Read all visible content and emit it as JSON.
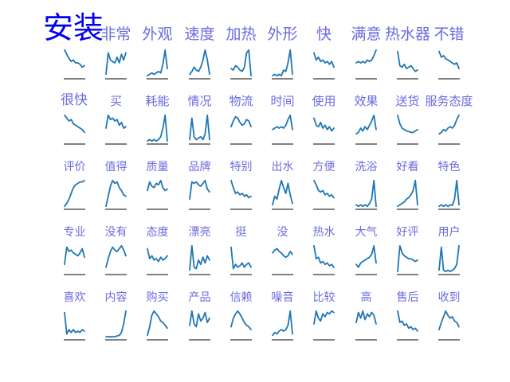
{
  "colors": {
    "line": "#1f77b4",
    "axis": "#000000",
    "label": "#6a6ae0",
    "highlight": "#0000ee",
    "background": "#ffffff"
  },
  "chart_data": {
    "type": "line",
    "title": "",
    "xlabel": "",
    "ylabel": "",
    "grid": false,
    "legend": "none",
    "layout": "small-multiples 10 columns x 5 rows; tick labels hidden; only bottom baseline shown",
    "panels": [
      {
        "label": "安装",
        "emphasis": true,
        "values": [
          0.95,
          0.8,
          0.65,
          0.55,
          0.6,
          0.5,
          0.5,
          0.45,
          0.35,
          0.4
        ]
      },
      {
        "label": "非常",
        "values": [
          0.1,
          0.85,
          0.6,
          0.55,
          0.5,
          0.7,
          0.5,
          0.8,
          0.6,
          0.85
        ]
      },
      {
        "label": "外观",
        "values": [
          0.05,
          0.1,
          0.15,
          0.1,
          0.15,
          0.2,
          0.15,
          0.45,
          0.95,
          0.3
        ]
      },
      {
        "label": "速度",
        "values": [
          0.1,
          0.2,
          0.35,
          0.25,
          0.2,
          0.35,
          0.6,
          0.95,
          0.6,
          0.1
        ]
      },
      {
        "label": "加热",
        "values": [
          0.3,
          0.25,
          0.4,
          0.35,
          0.25,
          0.2,
          0.35,
          0.85,
          0.95,
          0.05
        ]
      },
      {
        "label": "外形",
        "values": [
          0.05,
          0.1,
          0.05,
          0.1,
          0.05,
          0.25,
          0.2,
          0.5,
          0.95,
          0.1
        ]
      },
      {
        "label": "快",
        "values": [
          0.85,
          0.6,
          0.7,
          0.55,
          0.6,
          0.5,
          0.55,
          0.45,
          0.55,
          0.35
        ]
      },
      {
        "label": "满意",
        "values": [
          0.5,
          0.55,
          0.5,
          0.55,
          0.5,
          0.6,
          0.55,
          0.6,
          0.75,
          0.95
        ]
      },
      {
        "label": "热水器",
        "values": [
          0.9,
          0.4,
          0.35,
          0.45,
          0.3,
          0.35,
          0.4,
          0.3,
          0.2,
          0.25
        ]
      },
      {
        "label": "不错",
        "values": [
          0.9,
          0.7,
          0.75,
          0.65,
          0.6,
          0.55,
          0.5,
          0.45,
          0.5,
          0.3
        ]
      },
      {
        "label": "很快",
        "emphasis": true,
        "values": [
          0.95,
          0.85,
          0.75,
          0.8,
          0.65,
          0.6,
          0.55,
          0.5,
          0.45,
          0.35
        ]
      },
      {
        "label": "买",
        "values": [
          0.5,
          0.95,
          0.8,
          0.85,
          0.75,
          0.8,
          0.6,
          0.7,
          0.5,
          0.55
        ]
      },
      {
        "label": "耗能",
        "values": [
          0.05,
          0.1,
          0.05,
          0.1,
          0.05,
          0.1,
          0.2,
          0.5,
          0.95,
          0.05
        ]
      },
      {
        "label": "情况",
        "values": [
          0.1,
          0.85,
          0.2,
          0.1,
          0.15,
          0.2,
          0.1,
          0.3,
          0.95,
          0.1
        ]
      },
      {
        "label": "物流",
        "values": [
          0.55,
          0.75,
          0.9,
          0.85,
          0.7,
          0.6,
          0.65,
          0.8,
          0.75,
          0.55
        ]
      },
      {
        "label": "时间",
        "values": [
          0.45,
          0.5,
          0.55,
          0.5,
          0.55,
          0.5,
          0.6,
          0.8,
          0.95,
          0.45
        ]
      },
      {
        "label": "使用",
        "values": [
          0.85,
          0.6,
          0.55,
          0.7,
          0.5,
          0.6,
          0.45,
          0.55,
          0.4,
          0.5
        ]
      },
      {
        "label": "效果",
        "values": [
          0.3,
          0.35,
          0.5,
          0.4,
          0.55,
          0.45,
          0.6,
          0.75,
          0.95,
          0.45
        ]
      },
      {
        "label": "送货",
        "values": [
          0.95,
          0.65,
          0.5,
          0.45,
          0.4,
          0.38,
          0.35,
          0.35,
          0.4,
          0.45
        ]
      },
      {
        "label": "服务态度",
        "values": [
          0.3,
          0.35,
          0.45,
          0.4,
          0.5,
          0.55,
          0.5,
          0.6,
          0.8,
          0.95
        ]
      },
      {
        "label": "评价",
        "values": [
          0.05,
          0.15,
          0.3,
          0.5,
          0.7,
          0.8,
          0.85,
          0.9,
          0.9,
          0.95
        ]
      },
      {
        "label": "值得",
        "values": [
          0.05,
          0.4,
          0.75,
          0.95,
          0.85,
          0.9,
          0.7,
          0.6,
          0.45,
          0.4
        ]
      },
      {
        "label": "质量",
        "values": [
          0.6,
          0.9,
          0.75,
          0.7,
          0.85,
          0.8,
          0.95,
          0.7,
          0.6,
          0.65
        ]
      },
      {
        "label": "品牌",
        "values": [
          0.3,
          0.9,
          0.85,
          0.9,
          0.8,
          0.75,
          0.85,
          0.95,
          0.65,
          0.55
        ]
      },
      {
        "label": "特别",
        "values": [
          0.95,
          0.7,
          0.5,
          0.55,
          0.45,
          0.5,
          0.4,
          0.45,
          0.35,
          0.4
        ]
      },
      {
        "label": "出水",
        "values": [
          0.1,
          0.4,
          0.3,
          0.65,
          0.95,
          0.7,
          0.5,
          0.85,
          0.45,
          0.15
        ]
      },
      {
        "label": "方便",
        "values": [
          0.95,
          0.8,
          0.6,
          0.55,
          0.6,
          0.45,
          0.5,
          0.4,
          0.45,
          0.35
        ]
      },
      {
        "label": "洗浴",
        "values": [
          0.1,
          0.05,
          0.1,
          0.05,
          0.1,
          0.05,
          0.15,
          0.3,
          0.95,
          0.05
        ]
      },
      {
        "label": "好看",
        "values": [
          0.05,
          0.1,
          0.15,
          0.2,
          0.3,
          0.35,
          0.45,
          0.6,
          0.95,
          0.1
        ]
      },
      {
        "label": "特色",
        "values": [
          0.05,
          0.1,
          0.05,
          0.1,
          0.05,
          0.1,
          0.08,
          0.3,
          0.95,
          0.1
        ]
      },
      {
        "label": "专业",
        "values": [
          0.3,
          0.9,
          0.75,
          0.8,
          0.7,
          0.65,
          0.6,
          0.7,
          0.85,
          0.55
        ]
      },
      {
        "label": "没有",
        "values": [
          0.2,
          0.5,
          0.75,
          0.9,
          0.8,
          0.75,
          0.85,
          0.95,
          0.8,
          0.6
        ]
      },
      {
        "label": "态度",
        "values": [
          0.85,
          0.5,
          0.6,
          0.45,
          0.5,
          0.4,
          0.55,
          0.45,
          0.5,
          0.6
        ]
      },
      {
        "label": "漂亮",
        "values": [
          0.1,
          0.95,
          0.2,
          0.15,
          0.45,
          0.3,
          0.55,
          0.35,
          0.6,
          0.45
        ]
      },
      {
        "label": "挺",
        "values": [
          0.9,
          0.15,
          0.3,
          0.2,
          0.25,
          0.35,
          0.2,
          0.3,
          0.35,
          0.2
        ]
      },
      {
        "label": "没",
        "values": [
          0.7,
          0.8,
          0.85,
          0.75,
          0.7,
          0.6,
          0.55,
          0.6,
          0.75,
          0.65
        ]
      },
      {
        "label": "热水",
        "values": [
          0.95,
          0.5,
          0.55,
          0.35,
          0.4,
          0.3,
          0.35,
          0.25,
          0.3,
          0.2
        ]
      },
      {
        "label": "大气",
        "values": [
          0.3,
          0.2,
          0.35,
          0.4,
          0.45,
          0.5,
          0.55,
          0.65,
          0.95,
          0.35
        ]
      },
      {
        "label": "好评",
        "values": [
          0.05,
          0.95,
          0.7,
          0.6,
          0.55,
          0.5,
          0.5,
          0.45,
          0.4,
          0.45
        ]
      },
      {
        "label": "用户",
        "values": [
          0.1,
          0.9,
          0.1,
          0.05,
          0.1,
          0.05,
          0.1,
          0.15,
          0.3,
          0.95
        ]
      },
      {
        "label": "喜欢",
        "values": [
          0.9,
          0.15,
          0.3,
          0.2,
          0.3,
          0.2,
          0.25,
          0.2,
          0.3,
          0.25
        ]
      },
      {
        "label": "内容",
        "values": [
          0.05,
          0.05,
          0.05,
          0.05,
          0.05,
          0.08,
          0.1,
          0.2,
          0.5,
          0.95
        ]
      },
      {
        "label": "购买",
        "values": [
          0.1,
          0.4,
          0.8,
          0.95,
          0.85,
          0.75,
          0.6,
          0.55,
          0.45,
          0.35
        ]
      },
      {
        "label": "产品",
        "values": [
          0.45,
          0.95,
          0.5,
          0.4,
          0.85,
          0.6,
          0.7,
          0.9,
          0.55,
          0.7
        ]
      },
      {
        "label": "信赖",
        "values": [
          0.4,
          0.7,
          0.85,
          0.95,
          0.85,
          0.7,
          0.55,
          0.45,
          0.4,
          0.3
        ]
      },
      {
        "label": "噪音",
        "values": [
          0.1,
          0.2,
          0.15,
          0.25,
          0.3,
          0.25,
          0.3,
          0.45,
          0.95,
          0.15
        ]
      },
      {
        "label": "比较",
        "values": [
          0.5,
          0.95,
          0.7,
          0.6,
          0.85,
          0.75,
          0.9,
          0.85,
          0.95,
          0.9
        ]
      },
      {
        "label": "高",
        "values": [
          0.55,
          0.9,
          0.7,
          0.95,
          0.65,
          0.85,
          0.75,
          0.9,
          0.8,
          0.5
        ]
      },
      {
        "label": "售后",
        "values": [
          0.95,
          0.55,
          0.6,
          0.45,
          0.5,
          0.35,
          0.4,
          0.3,
          0.35,
          0.25
        ]
      },
      {
        "label": "收到",
        "values": [
          0.3,
          0.55,
          0.75,
          0.95,
          0.8,
          0.7,
          0.75,
          0.6,
          0.55,
          0.4
        ]
      }
    ]
  }
}
